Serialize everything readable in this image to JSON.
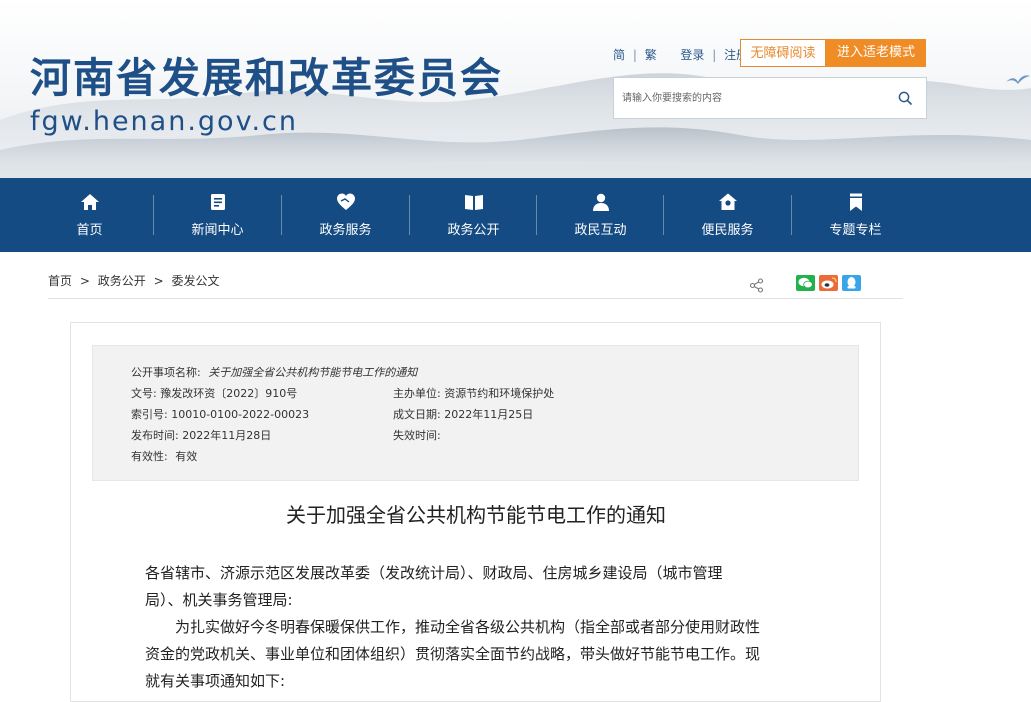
{
  "header": {
    "site_title": "河南省发展和改革委员会",
    "site_domain": "fgw.henan.gov.cn",
    "links": {
      "simplified": "简",
      "sep1": "|",
      "traditional": "繁",
      "login": "登录",
      "sep2": "|",
      "register": "注册"
    },
    "accessibility_button": "无障碍阅读",
    "elder_mode_button": "进入适老模式",
    "search": {
      "placeholder": "请输入你要搜索的内容",
      "value": ""
    }
  },
  "nav": {
    "items": [
      {
        "label": "首页",
        "icon": "home-icon"
      },
      {
        "label": "新闻中心",
        "icon": "news-icon"
      },
      {
        "label": "政务服务",
        "icon": "service-icon"
      },
      {
        "label": "政务公开",
        "icon": "book-icon"
      },
      {
        "label": "政民互动",
        "icon": "people-icon"
      },
      {
        "label": "便民服务",
        "icon": "house-icon"
      },
      {
        "label": "专题专栏",
        "icon": "bookmark-icon"
      }
    ]
  },
  "breadcrumb": {
    "items": [
      "首页",
      "政务公开",
      "委发公文"
    ],
    "separator": ">"
  },
  "share": {
    "icons": [
      "share-icon",
      "wechat-icon",
      "weibo-icon",
      "qq-icon"
    ]
  },
  "meta": {
    "name_label": "公开事项名称:",
    "name_value": "关于加强全省公共机构节能节电工作的通知",
    "doc_no_label": "文号:",
    "doc_no_value": "豫发改环资〔2022〕910号",
    "dept_label": "主办单位:",
    "dept_value": "资源节约和环境保护处",
    "index_label": "索引号:",
    "index_value": "10010-0100-2022-00023",
    "date_label": "成文日期:",
    "date_value": "2022年11月25日",
    "publish_label": "发布时间:",
    "publish_value": "2022年11月28日",
    "expire_label": "失效时间:",
    "expire_value": "",
    "validity_label": "有效性:",
    "validity_value": "有效"
  },
  "document": {
    "title": "关于加强全省公共机构节能节电工作的通知",
    "recipients_line1": "各省辖市、济源示范区发展改革委（发改统计局）、财政局、住房城乡建设局（城市管理",
    "recipients_line2": "局）、机关事务管理局:",
    "para1_line1": "为扎实做好今冬明春保暖保供工作，推动全省各级公共机构（指全部或者部分使用财政性",
    "para1_line2": "资金的党政机关、事业单位和团体组织）贯彻落实全面节约战略，带头做好节能节电工作。现",
    "para1_line3": "就有关事项通知如下:"
  },
  "colors": {
    "brand_blue": "#154b83",
    "title_blue": "#1e4f86",
    "accent_orange": "#f08c25"
  }
}
